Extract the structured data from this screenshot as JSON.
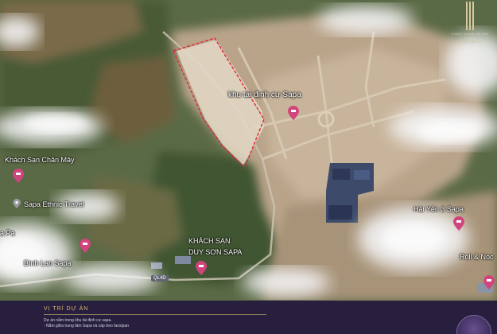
{
  "brand": {
    "subtitle": "CONG HOAN VA TAP DOAN",
    "name": "MAY BAC"
  },
  "map_labels": {
    "site": "khu tái định cư Sapa",
    "chan_may": "Khách Sạn Chân Mây",
    "ethnic": "Sapa Ethnic Travel",
    "sapa_edge": "a Pa",
    "binh_lan": "Bình Lan Sapa",
    "duy_son_1": "KHÁCH SẠN",
    "duy_son_2": "DUY SƠN SAPA",
    "hai_yen": "Hải Yến 3 Sapa",
    "roll": "Roll & Noc",
    "road": "QL4D"
  },
  "footer": {
    "title": "VỊ TRÍ DỰ ÁN",
    "line1": "Dự án nằm trong khu tái định cư sapa.",
    "line2": "- Nằm giữa trung tâm Sapa và cáp treo fansipan"
  },
  "colors": {
    "boundary": "#e0283a",
    "pin": "#d0457e",
    "footer_bg": "#271f3d",
    "accent_gold": "#d9b976"
  },
  "icons": [
    "hotel-pin-icon",
    "brand-logo-icon"
  ]
}
